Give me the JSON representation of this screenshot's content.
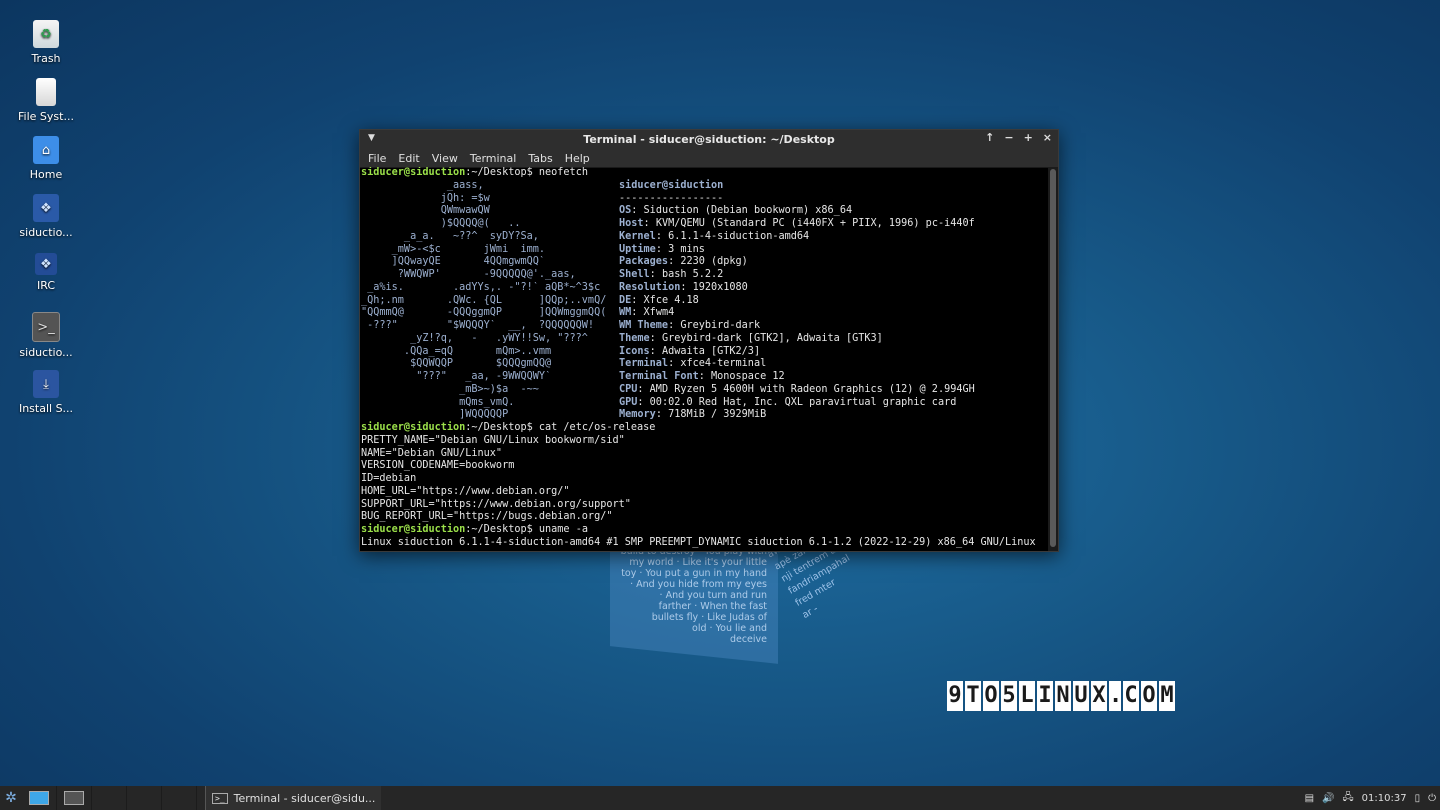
{
  "desktop": {
    "icons": [
      {
        "label": "Trash",
        "icon": "trash-icon"
      },
      {
        "label": "File Syst...",
        "icon": "filesystem-icon"
      },
      {
        "label": "Home",
        "icon": "home-folder-icon"
      },
      {
        "label": "siductio...",
        "icon": "siduction-icon"
      },
      {
        "label": "IRC",
        "icon": "irc-icon"
      },
      {
        "label": "siductio...",
        "icon": "terminal-launcher-icon"
      },
      {
        "label": "Install S...",
        "icon": "installer-icon"
      }
    ]
  },
  "wallpaper": {
    "lyrics": [
      "build to destroy · You play with",
      "my world · Like it's your little",
      "toy · You put a gun in my hand",
      "· And you hide from my eyes",
      "· And you turn and run",
      "farther · When the fast",
      "bullets fly · Like Judas of",
      "old · You lie and",
      "deceive"
    ],
    "lyrics_side": [
      "aw Ki",
      "apè zaman",
      "nji tentrem a",
      "fandriampahal",
      "fred mter",
      "ar -"
    ]
  },
  "window": {
    "title": "Terminal - siducer@siduction: ~/Desktop",
    "menu": [
      "File",
      "Edit",
      "View",
      "Terminal",
      "Tabs",
      "Help"
    ],
    "controls": {
      "up": "↑",
      "minimize": "−",
      "maximize": "+",
      "close": "×"
    }
  },
  "terminal": {
    "user_host": "siducer@siduction",
    "path": ":~/Desktop",
    "cmd1": "$ neofetch",
    "logo": [
      "              _aass,",
      "             jQh: =$w",
      "             QWmwawQW",
      "             )$QQQQ@(   ..",
      "       _a_a.   ~??^  syDY?Sa,",
      "     _mW>-<$c       jWmi  imm.",
      "     ]QQwayQE       4QQmgwmQQ`",
      "      ?WWQWP'       -9QQQQQ@'._aas,",
      " _a%is.        .adYYs,. -\"?!` aQB*~^3$c",
      "_Qh;.nm       .QWc. {QL      ]QQp;..vmQ/",
      "\"QQmmQ@       -QQQggmQP      ]QQWmggmQQ(",
      " -???\"        \"$WQQQY`  __,  ?QQQQQQW!",
      "        _yZ!?q,   -   .yWY!!Sw, \"???^",
      "       .QQa_=qQ       mQm>..vmm",
      "        $QQWQQP       $QQQgmQQ@",
      "         \"???\"   _aa, -9WWQQWY`",
      "                _mB>~)$a  -~~",
      "                mQms_vmQ.",
      "                ]WQQQQQP"
    ],
    "header": "siducer@siduction",
    "separator": "-----------------",
    "info": [
      {
        "label": "OS",
        "value": ": Siduction (Debian bookworm) x86_64"
      },
      {
        "label": "Host",
        "value": ": KVM/QEMU (Standard PC (i440FX + PIIX, 1996) pc-i440f"
      },
      {
        "label": "Kernel",
        "value": ": 6.1.1-4-siduction-amd64"
      },
      {
        "label": "Uptime",
        "value": ": 3 mins"
      },
      {
        "label": "Packages",
        "value": ": 2230 (dpkg)"
      },
      {
        "label": "Shell",
        "value": ": bash 5.2.2"
      },
      {
        "label": "Resolution",
        "value": ": 1920x1080"
      },
      {
        "label": "DE",
        "value": ": Xfce 4.18"
      },
      {
        "label": "WM",
        "value": ": Xfwm4"
      },
      {
        "label": "WM Theme",
        "value": ": Greybird-dark"
      },
      {
        "label": "Theme",
        "value": ": Greybird-dark [GTK2], Adwaita [GTK3]"
      },
      {
        "label": "Icons",
        "value": ": Adwaita [GTK2/3]"
      },
      {
        "label": "Terminal",
        "value": ": xfce4-terminal"
      },
      {
        "label": "Terminal Font",
        "value": ": Monospace 12"
      },
      {
        "label": "CPU",
        "value": ": AMD Ryzen 5 4600H with Radeon Graphics (12) @ 2.994GH"
      },
      {
        "label": "GPU",
        "value": ": 00:02.0 Red Hat, Inc. QXL paravirtual graphic card"
      },
      {
        "label": "Memory",
        "value": ": 718MiB / 3929MiB"
      }
    ],
    "cmd2": "$ cat /etc/os-release",
    "os_release": [
      "PRETTY_NAME=\"Debian GNU/Linux bookworm/sid\"",
      "NAME=\"Debian GNU/Linux\"",
      "VERSION_CODENAME=bookworm",
      "ID=debian",
      "HOME_URL=\"https://www.debian.org/\"",
      "SUPPORT_URL=\"https://www.debian.org/support\"",
      "BUG_REPORT_URL=\"https://bugs.debian.org/\""
    ],
    "cmd3": "$ uname -a",
    "uname_output": "Linux siduction 6.1.1-4-siduction-amd64 #1 SMP PREEMPT_DYNAMIC siduction 6.1-1.2 (2022-12-29) x86_64 GNU/Linux"
  },
  "watermark": [
    "9",
    "T",
    "O",
    "5",
    "L",
    "I",
    "N",
    "U",
    "X",
    ".",
    "C",
    "O",
    "M"
  ],
  "taskbar": {
    "task_label": "Terminal - siducer@sidu...",
    "clock": "01:10:37"
  }
}
